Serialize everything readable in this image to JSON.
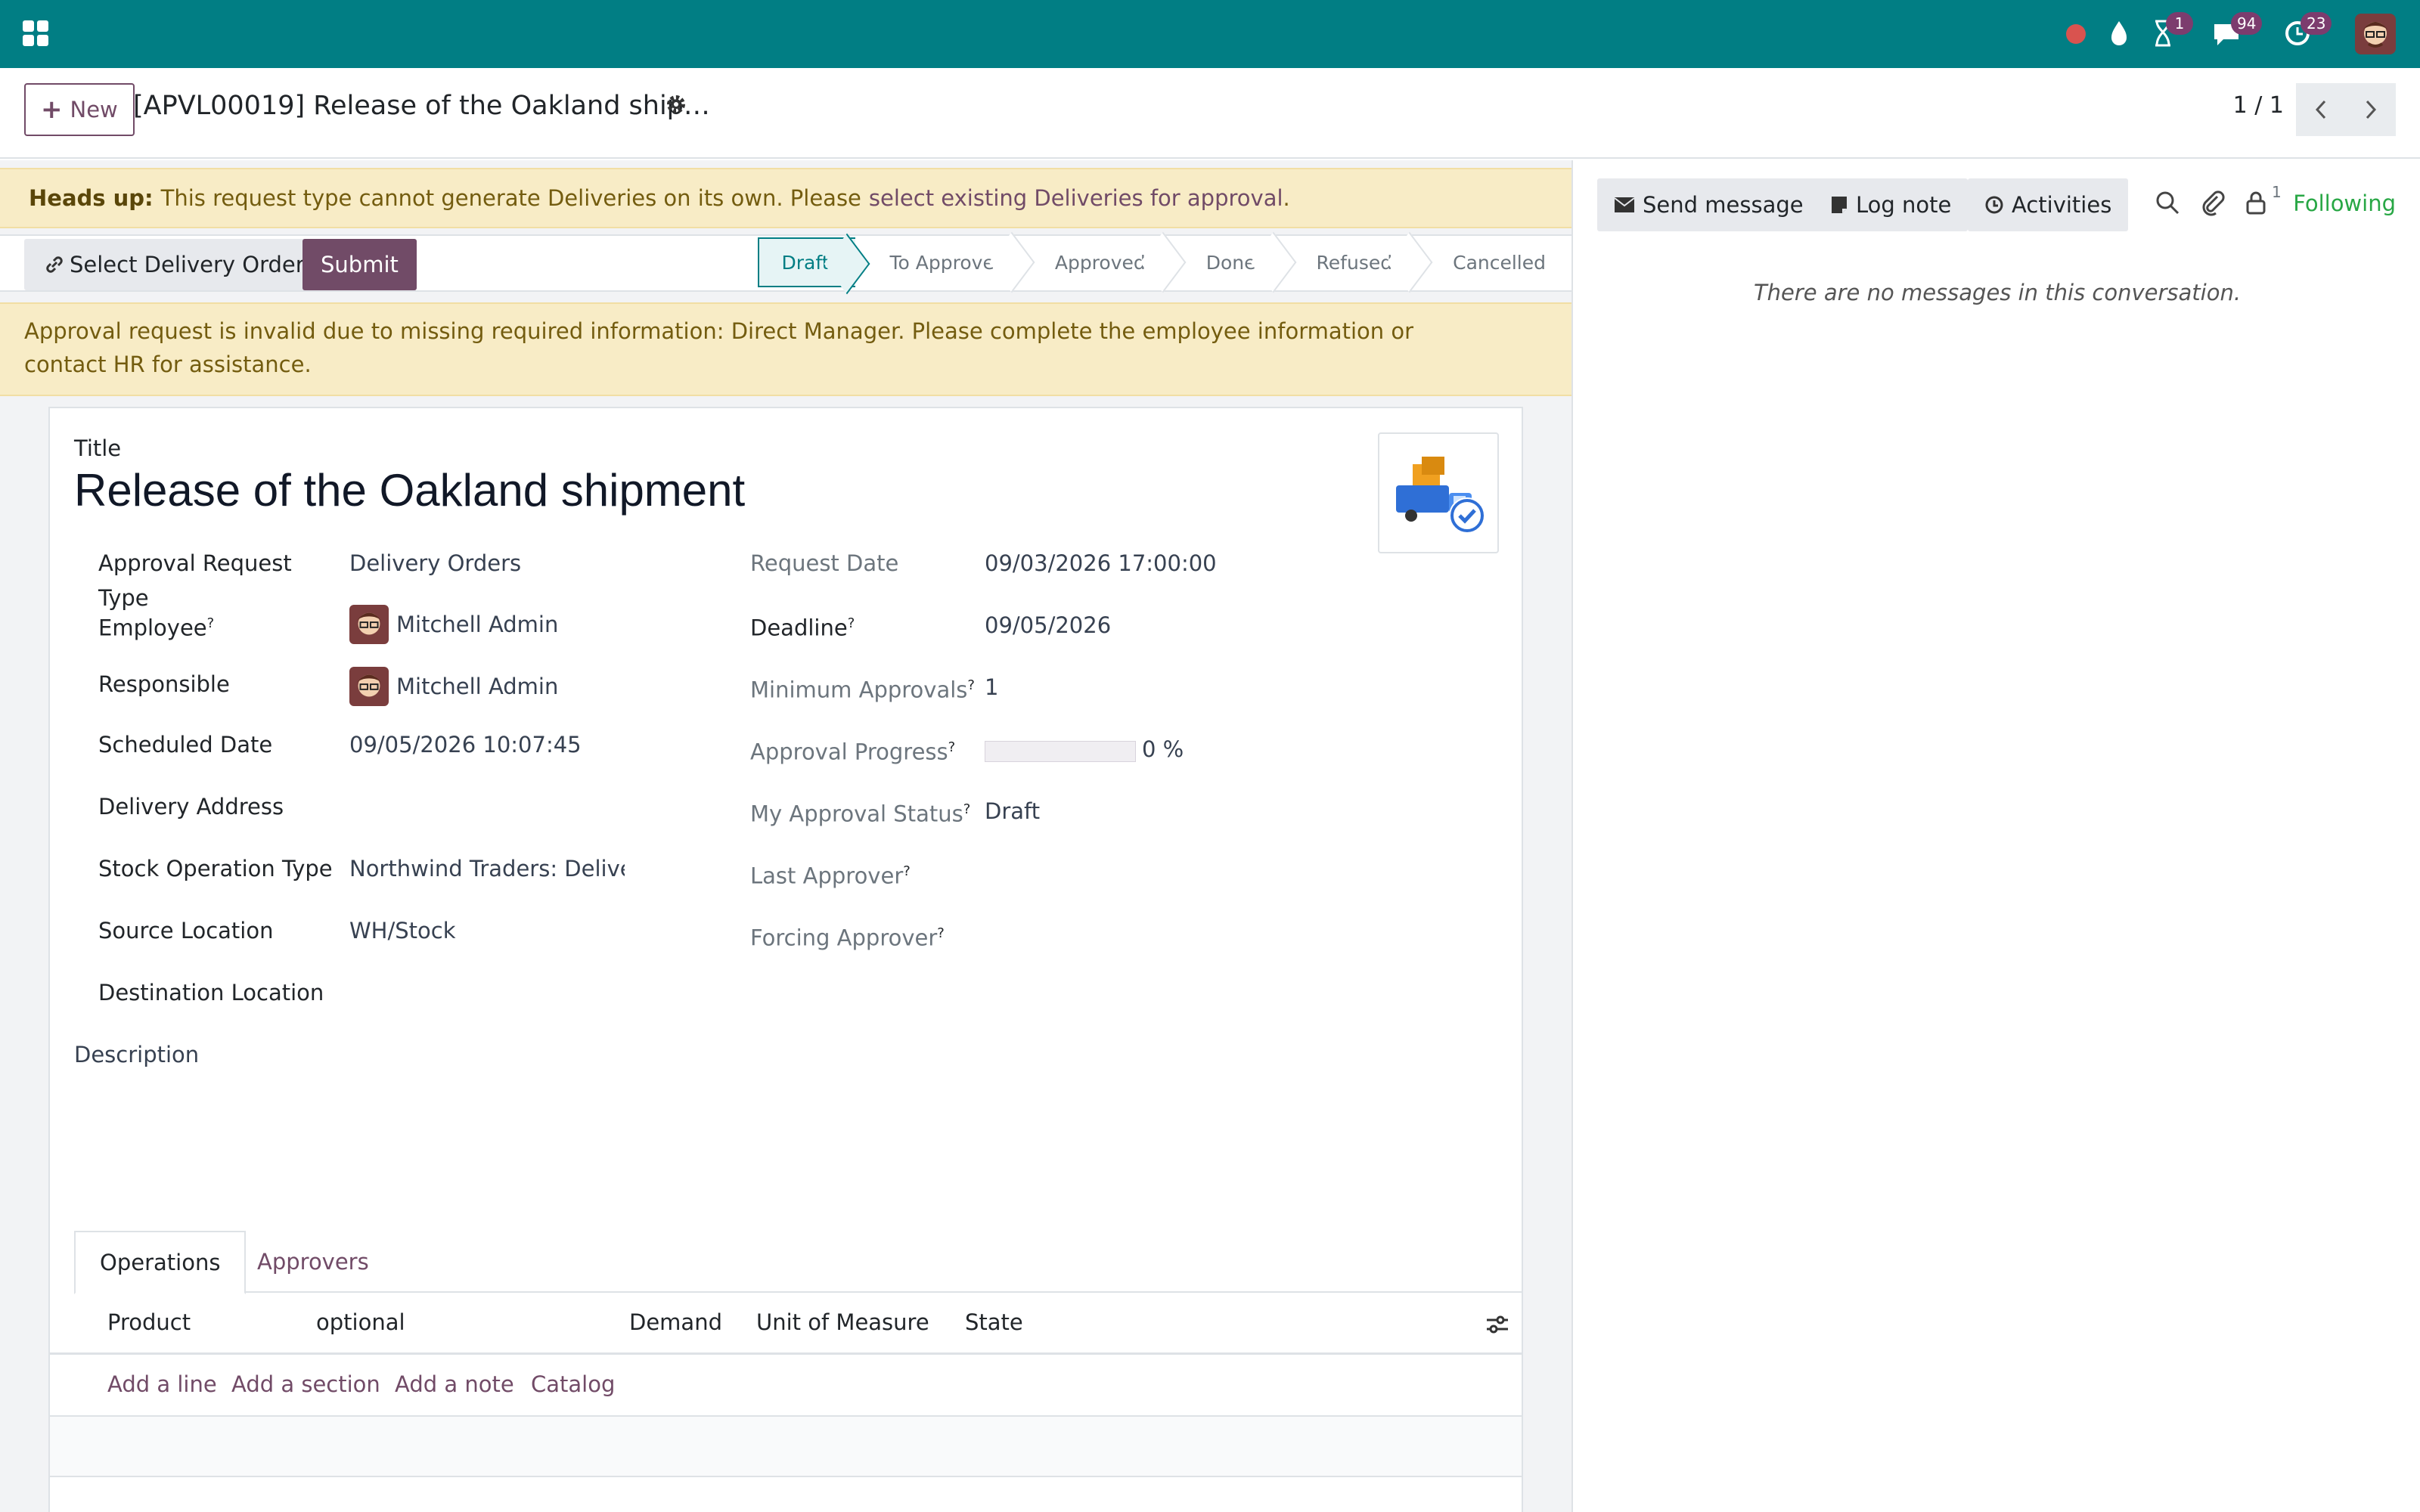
{
  "navbar": {
    "apps_icon": "apps-grid-icon",
    "activity_badge": "1",
    "messages_badge": "94",
    "clock_badge": "23",
    "accent_color": "#017e84"
  },
  "control_panel": {
    "new_label": "New",
    "record_title": "[APVL00019] Release of the Oakland ship…",
    "pager": "1 / 1"
  },
  "alert_heads_up": {
    "strong": "Heads up:",
    "text": "This request type cannot generate Deliveries on its own. Please",
    "link": "select existing Deliveries for approval",
    "end": "."
  },
  "actions": {
    "select_delivery": "Select Delivery Order",
    "submit": "Submit"
  },
  "stages": [
    "Draft",
    "To Approve",
    "Approved",
    "Done",
    "Refused",
    "Cancelled"
  ],
  "alert_invalid": "Approval request is invalid due to missing required information: Direct Manager. Please complete the employee information or contact HR for assistance.",
  "form": {
    "title_label": "Title",
    "title_value": "Release of the Oakland shipment",
    "left": {
      "approval_type_label": "Approval Request Type",
      "approval_type_value": "Delivery Orders",
      "employee_label": "Employee",
      "employee_value": "Mitchell Admin",
      "responsible_label": "Responsible",
      "responsible_value": "Mitchell Admin",
      "scheduled_label": "Scheduled Date",
      "scheduled_value": "09/05/2026 10:07:45",
      "delivery_address_label": "Delivery Address",
      "delivery_address_value": "",
      "op_type_label": "Stock Operation Type",
      "op_type_value": "Northwind Traders: Delivery",
      "source_label": "Source Location",
      "source_value": "WH/Stock",
      "dest_label": "Destination Location",
      "dest_value": ""
    },
    "right": {
      "request_date_label": "Request Date",
      "request_date_value": "09/03/2026 17:00:00",
      "deadline_label": "Deadline",
      "deadline_value": "09/05/2026",
      "min_approvals_label": "Minimum Approvals",
      "min_approvals_value": "1",
      "progress_label": "Approval Progress",
      "progress_value": "0 %",
      "progress_fraction": 0,
      "status_label": "My Approval Status",
      "status_value": "Draft",
      "last_approver_label": "Last Approver",
      "forcing_approver_label": "Forcing Approver"
    },
    "description_label": "Description",
    "help_marker": "?"
  },
  "tabs": {
    "operations": "Operations",
    "approvers": "Approvers"
  },
  "operations_table": {
    "columns": [
      "Product",
      "optional",
      "Demand",
      "Unit of Measure",
      "State"
    ],
    "add_line": "Add a line",
    "add_section": "Add a section",
    "add_note": "Add a note",
    "catalog": "Catalog"
  },
  "chatter": {
    "send_message": "Send message",
    "log_note": "Log note",
    "activities": "Activities",
    "followers_count": "1",
    "following": "Following",
    "empty": "There are no messages in this conversation."
  }
}
